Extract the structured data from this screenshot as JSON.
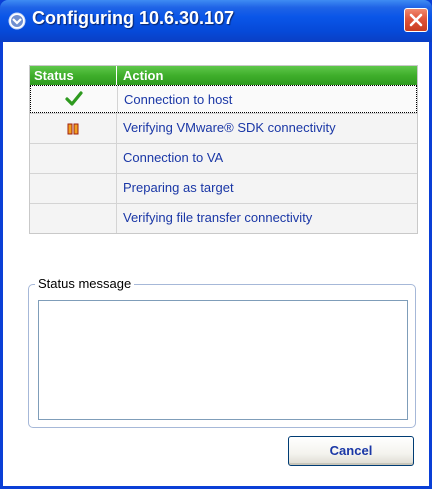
{
  "window": {
    "title": "Configuring 10.6.30.107",
    "icon": "vmware-gear-icon",
    "colors": {
      "titlebar": "#0a56e8",
      "close_button": "#e0553a",
      "table_header": "#3fae2b",
      "action_text": "#1a37a6"
    }
  },
  "table": {
    "headers": {
      "status": "Status",
      "action": "Action"
    },
    "rows": [
      {
        "status_icon": "checkmark-icon",
        "status": "done",
        "action": "Connection to host"
      },
      {
        "status_icon": "pause-icon",
        "status": "in-progress",
        "action": "Verifying VMware® SDK connectivity"
      },
      {
        "status_icon": "",
        "status": "pending",
        "action": "Connection to VA"
      },
      {
        "status_icon": "",
        "status": "pending",
        "action": "Preparing as target"
      },
      {
        "status_icon": "",
        "status": "pending",
        "action": "Verifying file transfer connectivity"
      }
    ]
  },
  "status_group": {
    "label": "Status message",
    "value": ""
  },
  "buttons": {
    "cancel": "Cancel"
  }
}
